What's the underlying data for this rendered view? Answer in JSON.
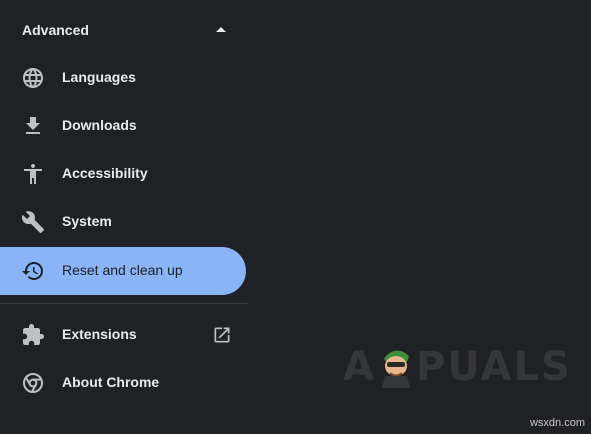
{
  "advanced": {
    "label": "Advanced",
    "icon": "caret-up-icon"
  },
  "nav": {
    "items": [
      {
        "label": "Languages",
        "icon": "globe-icon"
      },
      {
        "label": "Downloads",
        "icon": "download-icon"
      },
      {
        "label": "Accessibility",
        "icon": "accessibility-icon"
      },
      {
        "label": "System",
        "icon": "wrench-icon"
      },
      {
        "label": "Reset and clean up",
        "icon": "restore-icon",
        "active": true
      }
    ],
    "secondary": [
      {
        "label": "Extensions",
        "icon": "puzzle-icon",
        "trailing_icon": "open-in-new-icon"
      },
      {
        "label": "About Chrome",
        "icon": "chrome-icon"
      }
    ]
  },
  "branding": {
    "logo_text_left": "A",
    "logo_text_right": "PUALS",
    "watermark": "wsxdn.com"
  },
  "colors": {
    "background": "#202124",
    "text": "#e8eaed",
    "icon": "#bdc1c6",
    "active_background": "#8ab4f8",
    "active_text": "#202124",
    "divider": "#3c4043"
  }
}
